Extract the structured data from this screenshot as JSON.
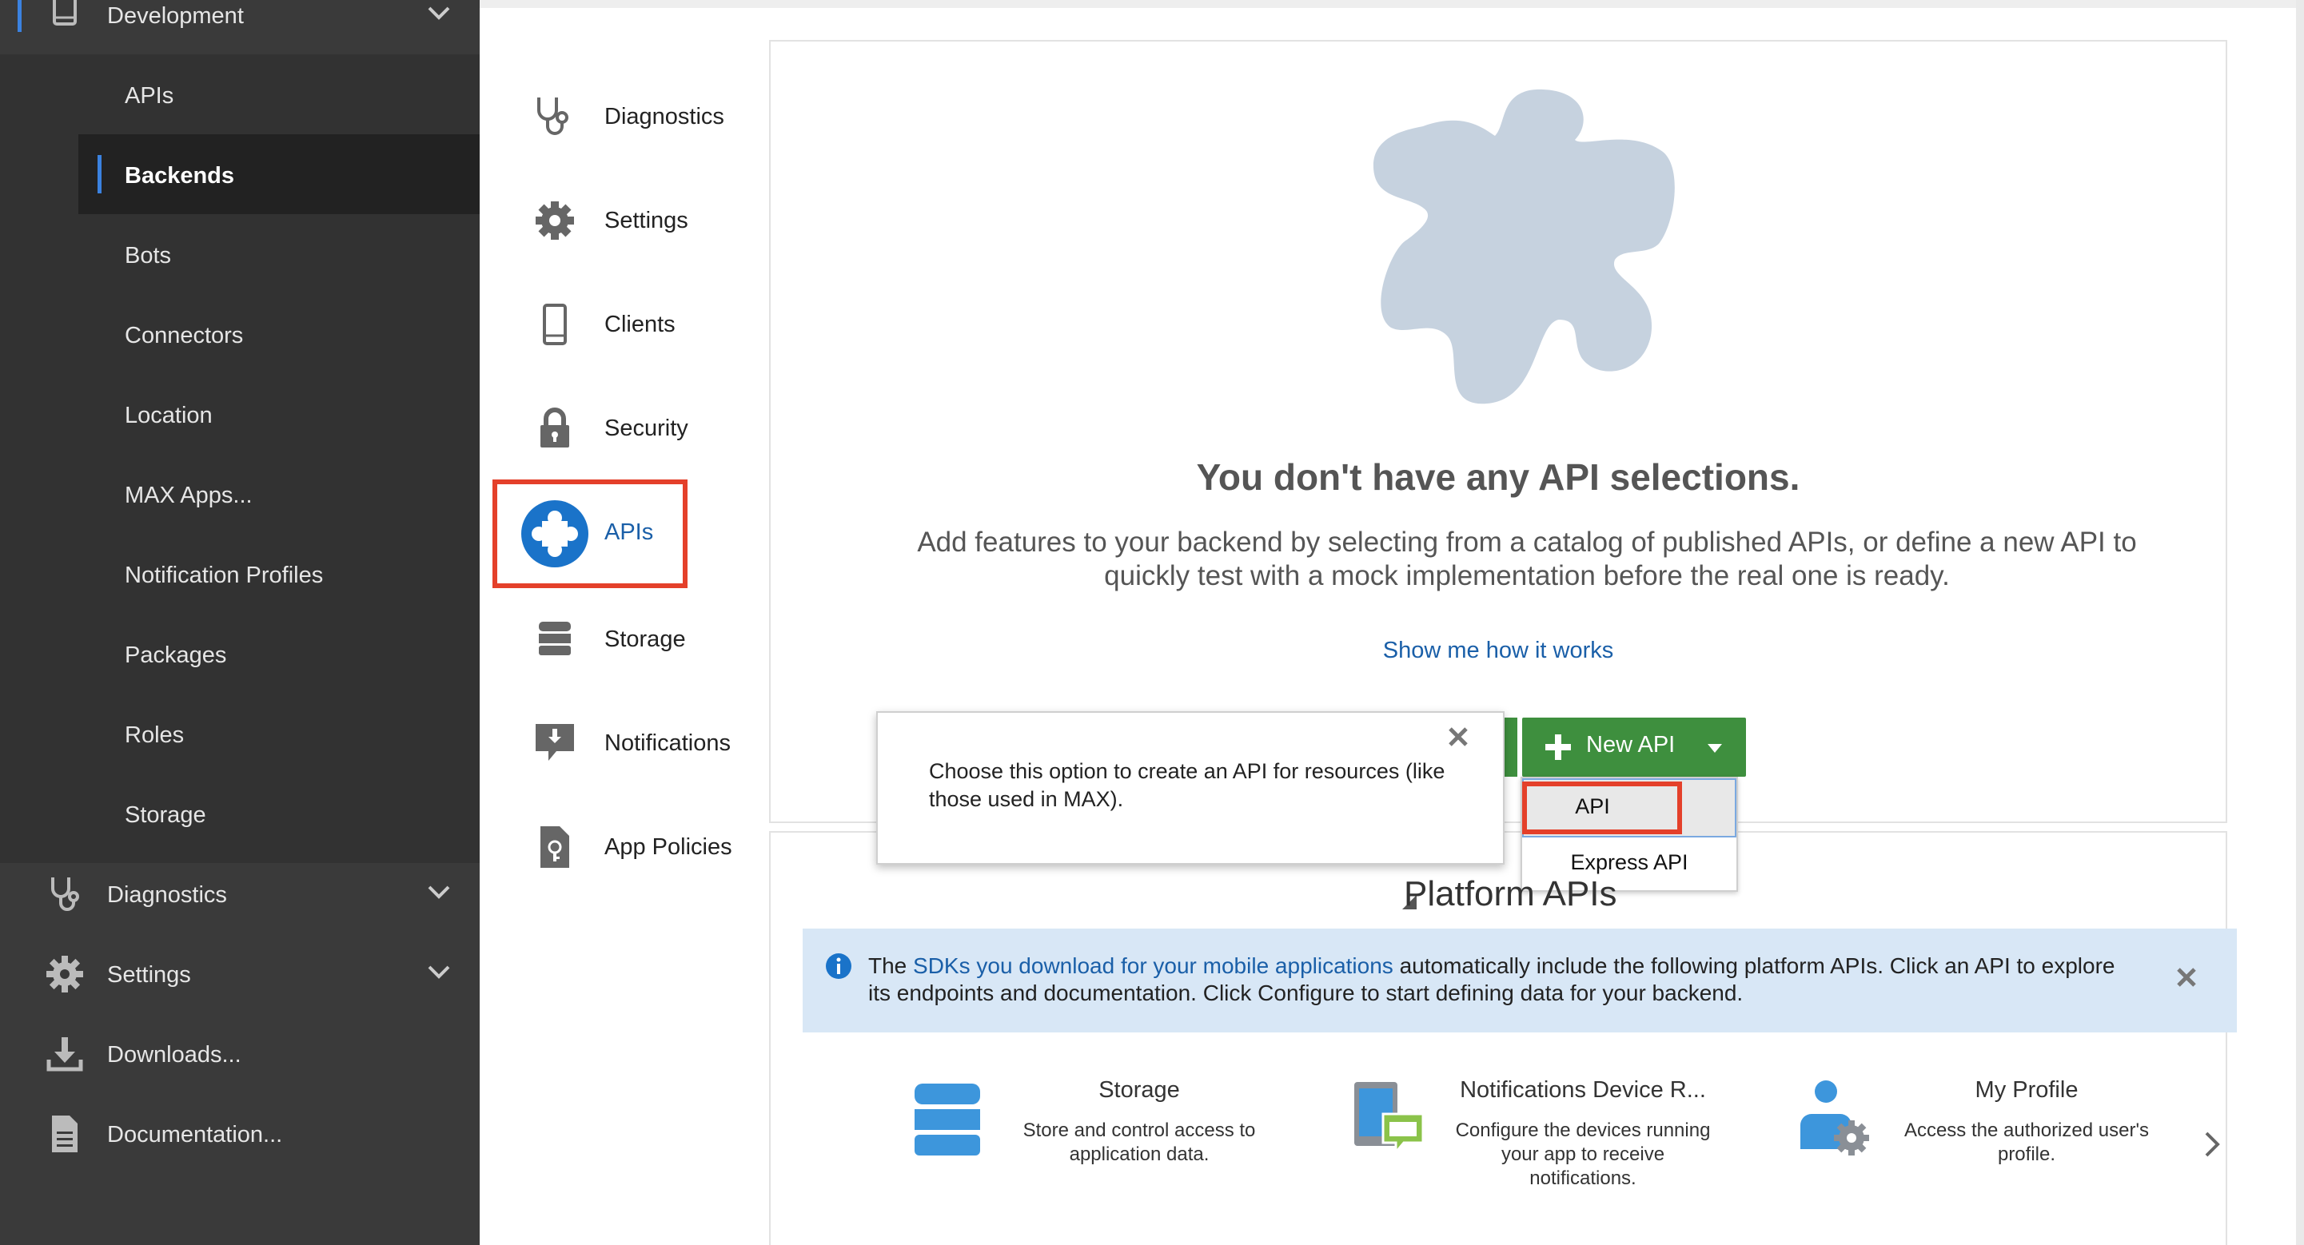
{
  "colors": {
    "sidebar_bg": "#3a3a3a",
    "accent_blue": "#1a5fa8",
    "green": "#3e8f3e",
    "highlight_red": "#e4402a",
    "info_bg": "#d8e7f6"
  },
  "sidebar": {
    "development": {
      "label": "Development",
      "icon": "mobile-icon"
    },
    "dev_items": [
      "APIs",
      "Backends",
      "Bots",
      "Connectors",
      "Location",
      "MAX Apps...",
      "Notification Profiles",
      "Packages",
      "Roles",
      "Storage"
    ],
    "selected": "Backends",
    "diagnostics": {
      "label": "Diagnostics",
      "icon": "stethoscope-icon"
    },
    "settings": {
      "label": "Settings",
      "icon": "gear-icon"
    },
    "downloads": {
      "label": "Downloads...",
      "icon": "download-icon"
    },
    "documentation": {
      "label": "Documentation...",
      "icon": "document-icon"
    }
  },
  "subnav": {
    "items": [
      {
        "label": "Diagnostics",
        "icon": "stethoscope-icon"
      },
      {
        "label": "Settings",
        "icon": "gear-icon"
      },
      {
        "label": "Clients",
        "icon": "mobile-icon"
      },
      {
        "label": "Security",
        "icon": "lock-icon"
      },
      {
        "label": "APIs",
        "icon": "puzzle-icon"
      },
      {
        "label": "Storage",
        "icon": "database-icon"
      },
      {
        "label": "Notifications",
        "icon": "notification-icon"
      },
      {
        "label": "App Policies",
        "icon": "policy-icon"
      }
    ],
    "active": "APIs"
  },
  "empty_state": {
    "title": "You don't have any API selections.",
    "description": "Add features to your backend by selecting from a catalog of published APIs, or define a new API to quickly test with a mock implementation before the real one is ready.",
    "link": "Show me how it works"
  },
  "new_api": {
    "label": "New API",
    "options": [
      "API",
      "Express API"
    ]
  },
  "tooltip": {
    "text": "Choose this option to create an API for resources (like those used in MAX)."
  },
  "platform_apis": {
    "title": "Platform APIs",
    "info_prefix": "The ",
    "info_link": "SDKs you download for your mobile applications",
    "info_suffix": " automatically include the following platform APIs. Click an API to explore its endpoints and documentation. Click Configure to start defining data for your backend.",
    "tiles": [
      {
        "title": "Storage",
        "description": "Store and control access to application data.",
        "icon": "database-icon"
      },
      {
        "title": "Notifications Device R...",
        "description": "Configure the devices running your app to receive notifications.",
        "icon": "device-notification-icon"
      },
      {
        "title": "My Profile",
        "description": "Access the authorized user's profile.",
        "icon": "user-settings-icon"
      }
    ]
  }
}
